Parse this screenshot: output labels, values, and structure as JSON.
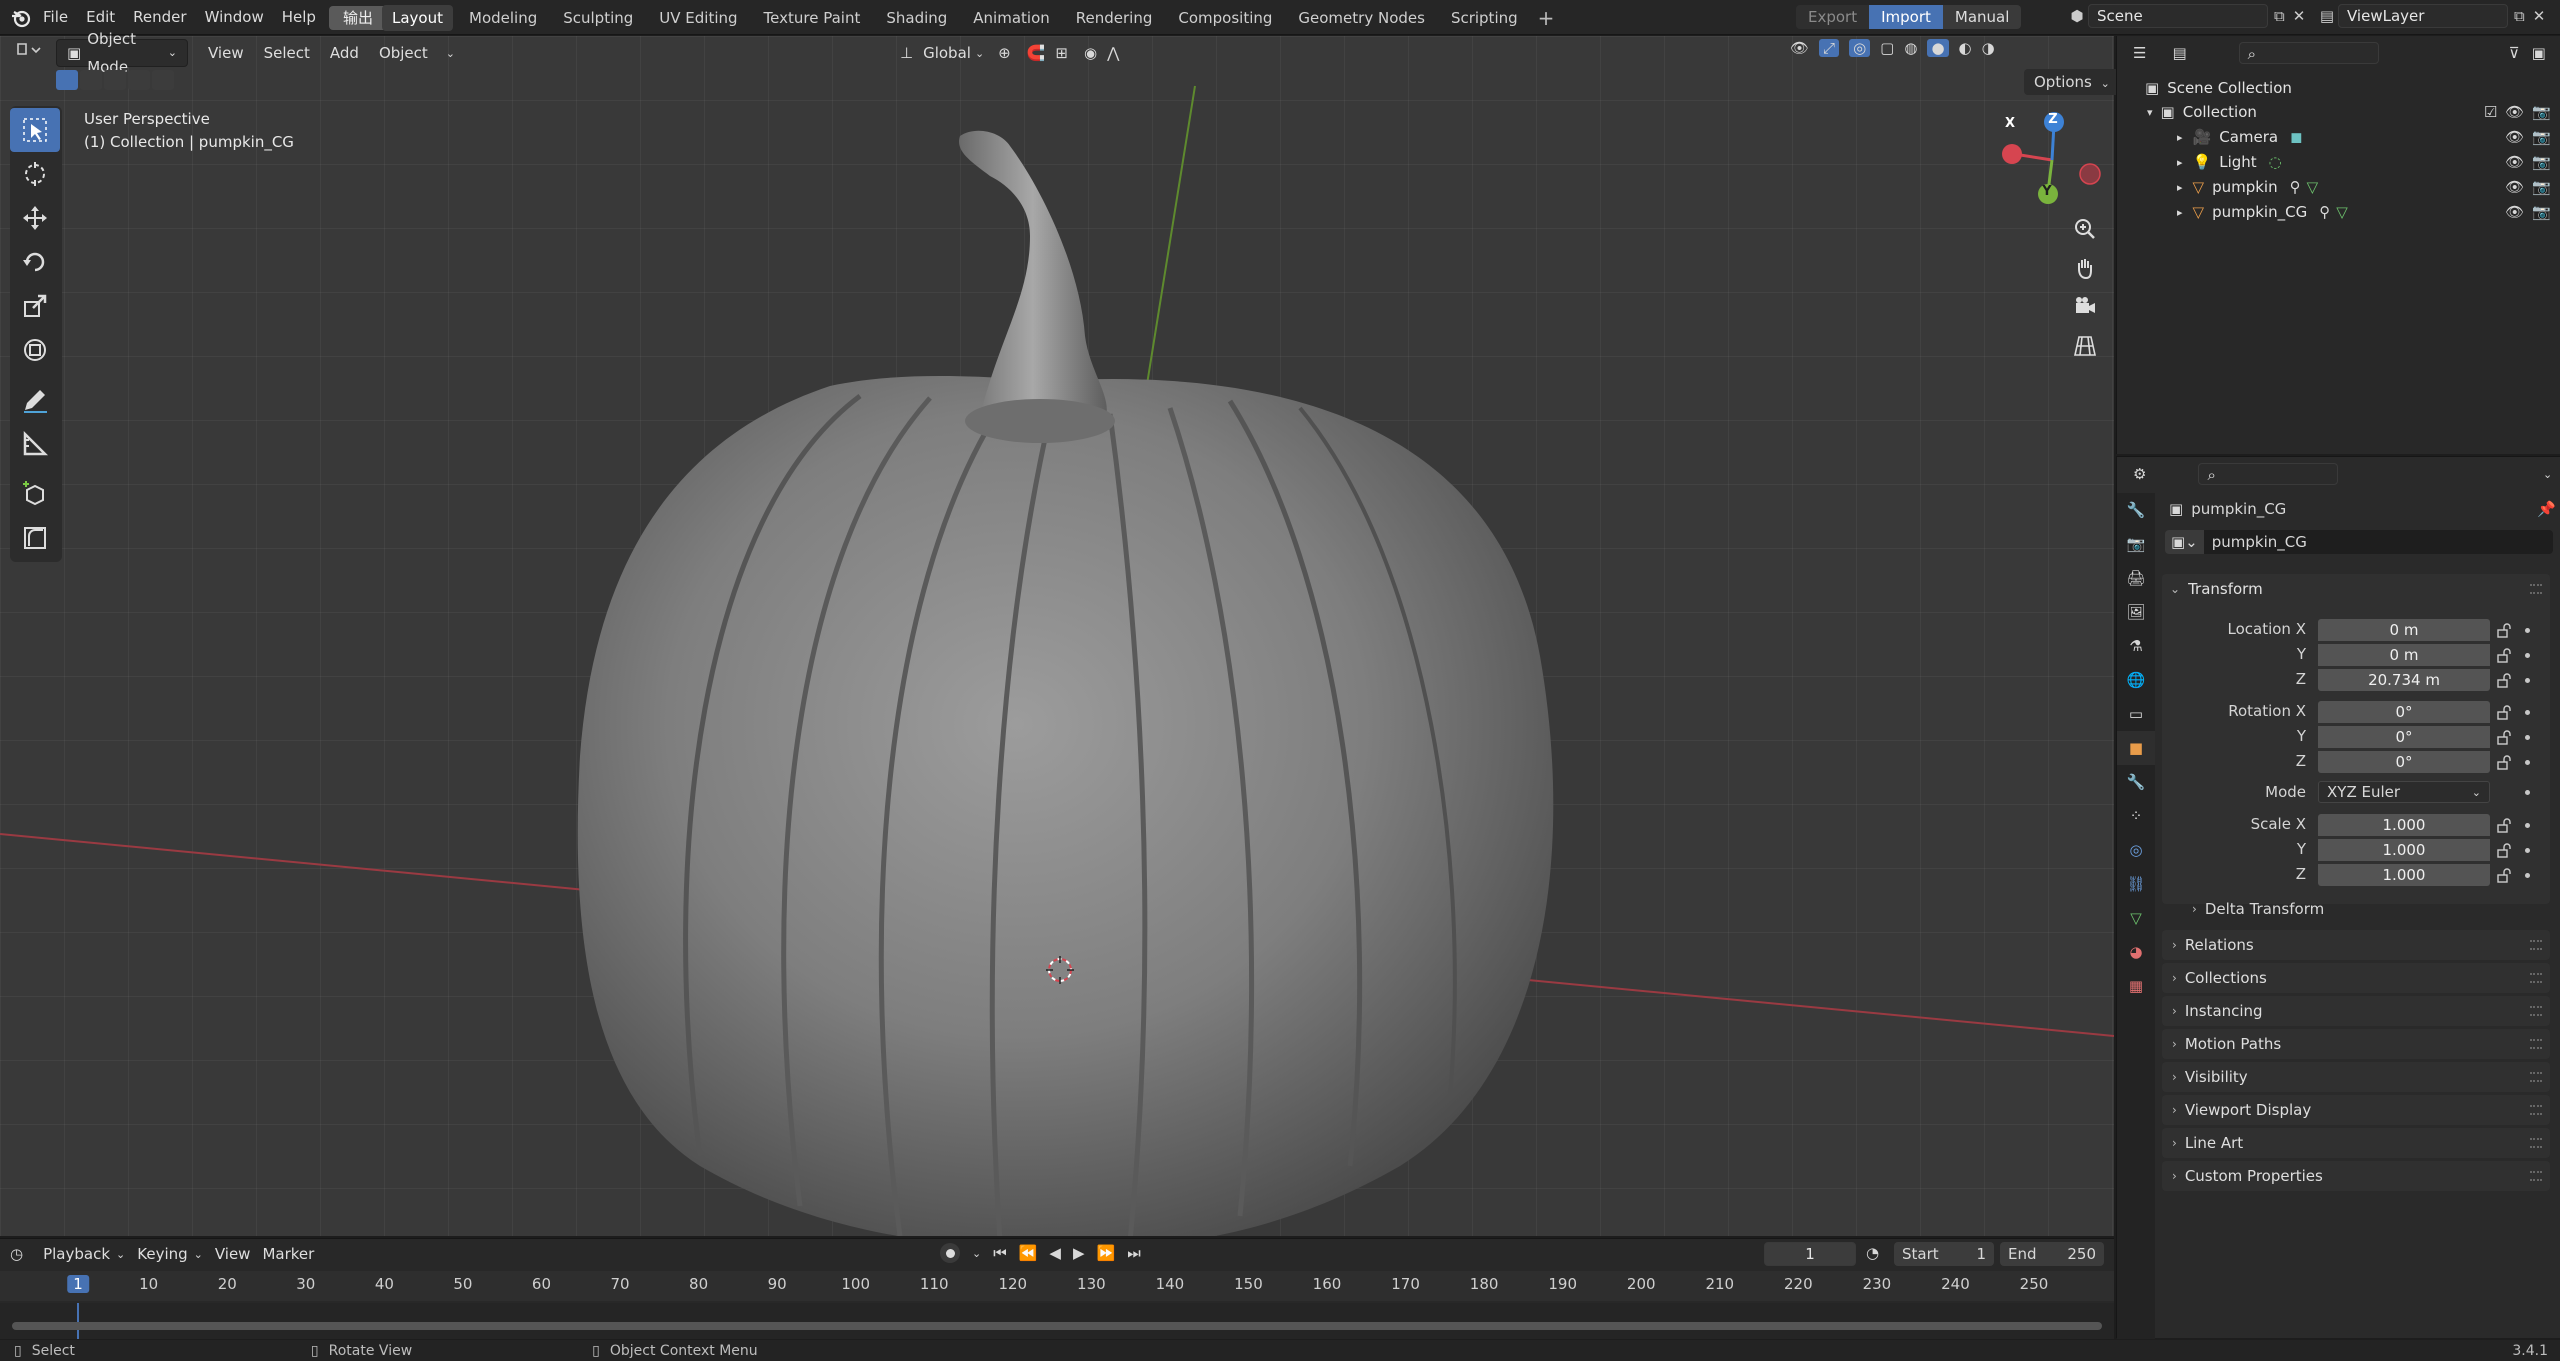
{
  "topbar": {
    "menus": [
      "File",
      "Edit",
      "Render",
      "Window",
      "Help"
    ],
    "special_menu": "输出",
    "workspaces": [
      "Layout",
      "Modeling",
      "Sculpting",
      "UV Editing",
      "Texture Paint",
      "Shading",
      "Animation",
      "Rendering",
      "Compositing",
      "Geometry Nodes",
      "Scripting"
    ],
    "active_workspace": "Layout",
    "export_label": "Export",
    "import_label": "Import",
    "manual_label": "Manual",
    "scene_name": "Scene",
    "view_layer": "ViewLayer"
  },
  "viewport": {
    "mode": "Object Mode",
    "menus": [
      "View",
      "Select",
      "Add",
      "Object"
    ],
    "transform_orientation": "Global",
    "options_label": "Options",
    "info_line1": "User Perspective",
    "info_line2": "(1) Collection | pumpkin_CG",
    "gizmo": {
      "x": "X",
      "y": "Y",
      "z": "Z"
    }
  },
  "outliner": {
    "root": "Scene Collection",
    "collection": "Collection",
    "items": [
      "Camera",
      "Light",
      "pumpkin",
      "pumpkin_CG"
    ]
  },
  "properties": {
    "object_name": "pumpkin_CG",
    "data_name": "pumpkin_CG",
    "transform_title": "Transform",
    "location": {
      "label_x": "Location X",
      "label_y": "Y",
      "label_z": "Z",
      "x": "0 m",
      "y": "0 m",
      "z": "20.734 m"
    },
    "rotation": {
      "label_x": "Rotation X",
      "label_y": "Y",
      "label_z": "Z",
      "x": "0°",
      "y": "0°",
      "z": "0°"
    },
    "mode_label": "Mode",
    "mode_value": "XYZ Euler",
    "scale": {
      "label_x": "Scale X",
      "label_y": "Y",
      "label_z": "Z",
      "x": "1.000",
      "y": "1.000",
      "z": "1.000"
    },
    "delta_transform": "Delta Transform",
    "panels": [
      "Relations",
      "Collections",
      "Instancing",
      "Motion Paths",
      "Visibility",
      "Viewport Display",
      "Line Art",
      "Custom Properties"
    ]
  },
  "timeline": {
    "menus": [
      "Playback",
      "Keying",
      "View",
      "Marker"
    ],
    "current_frame": "1",
    "start_label": "Start",
    "start_value": "1",
    "end_label": "End",
    "end_value": "250",
    "ticks": [
      "1",
      "10",
      "20",
      "30",
      "40",
      "50",
      "60",
      "70",
      "80",
      "90",
      "100",
      "110",
      "120",
      "130",
      "140",
      "150",
      "160",
      "170",
      "180",
      "190",
      "200",
      "210",
      "220",
      "230",
      "240",
      "250"
    ]
  },
  "statusbar": {
    "select": "Select",
    "rotate": "Rotate View",
    "context": "Object Context Menu",
    "version": "3.4.1"
  },
  "colors": {
    "accent": "#4772b3",
    "x_axis": "#d64550",
    "y_axis": "#7ab33d",
    "z_axis": "#3d82d6"
  }
}
